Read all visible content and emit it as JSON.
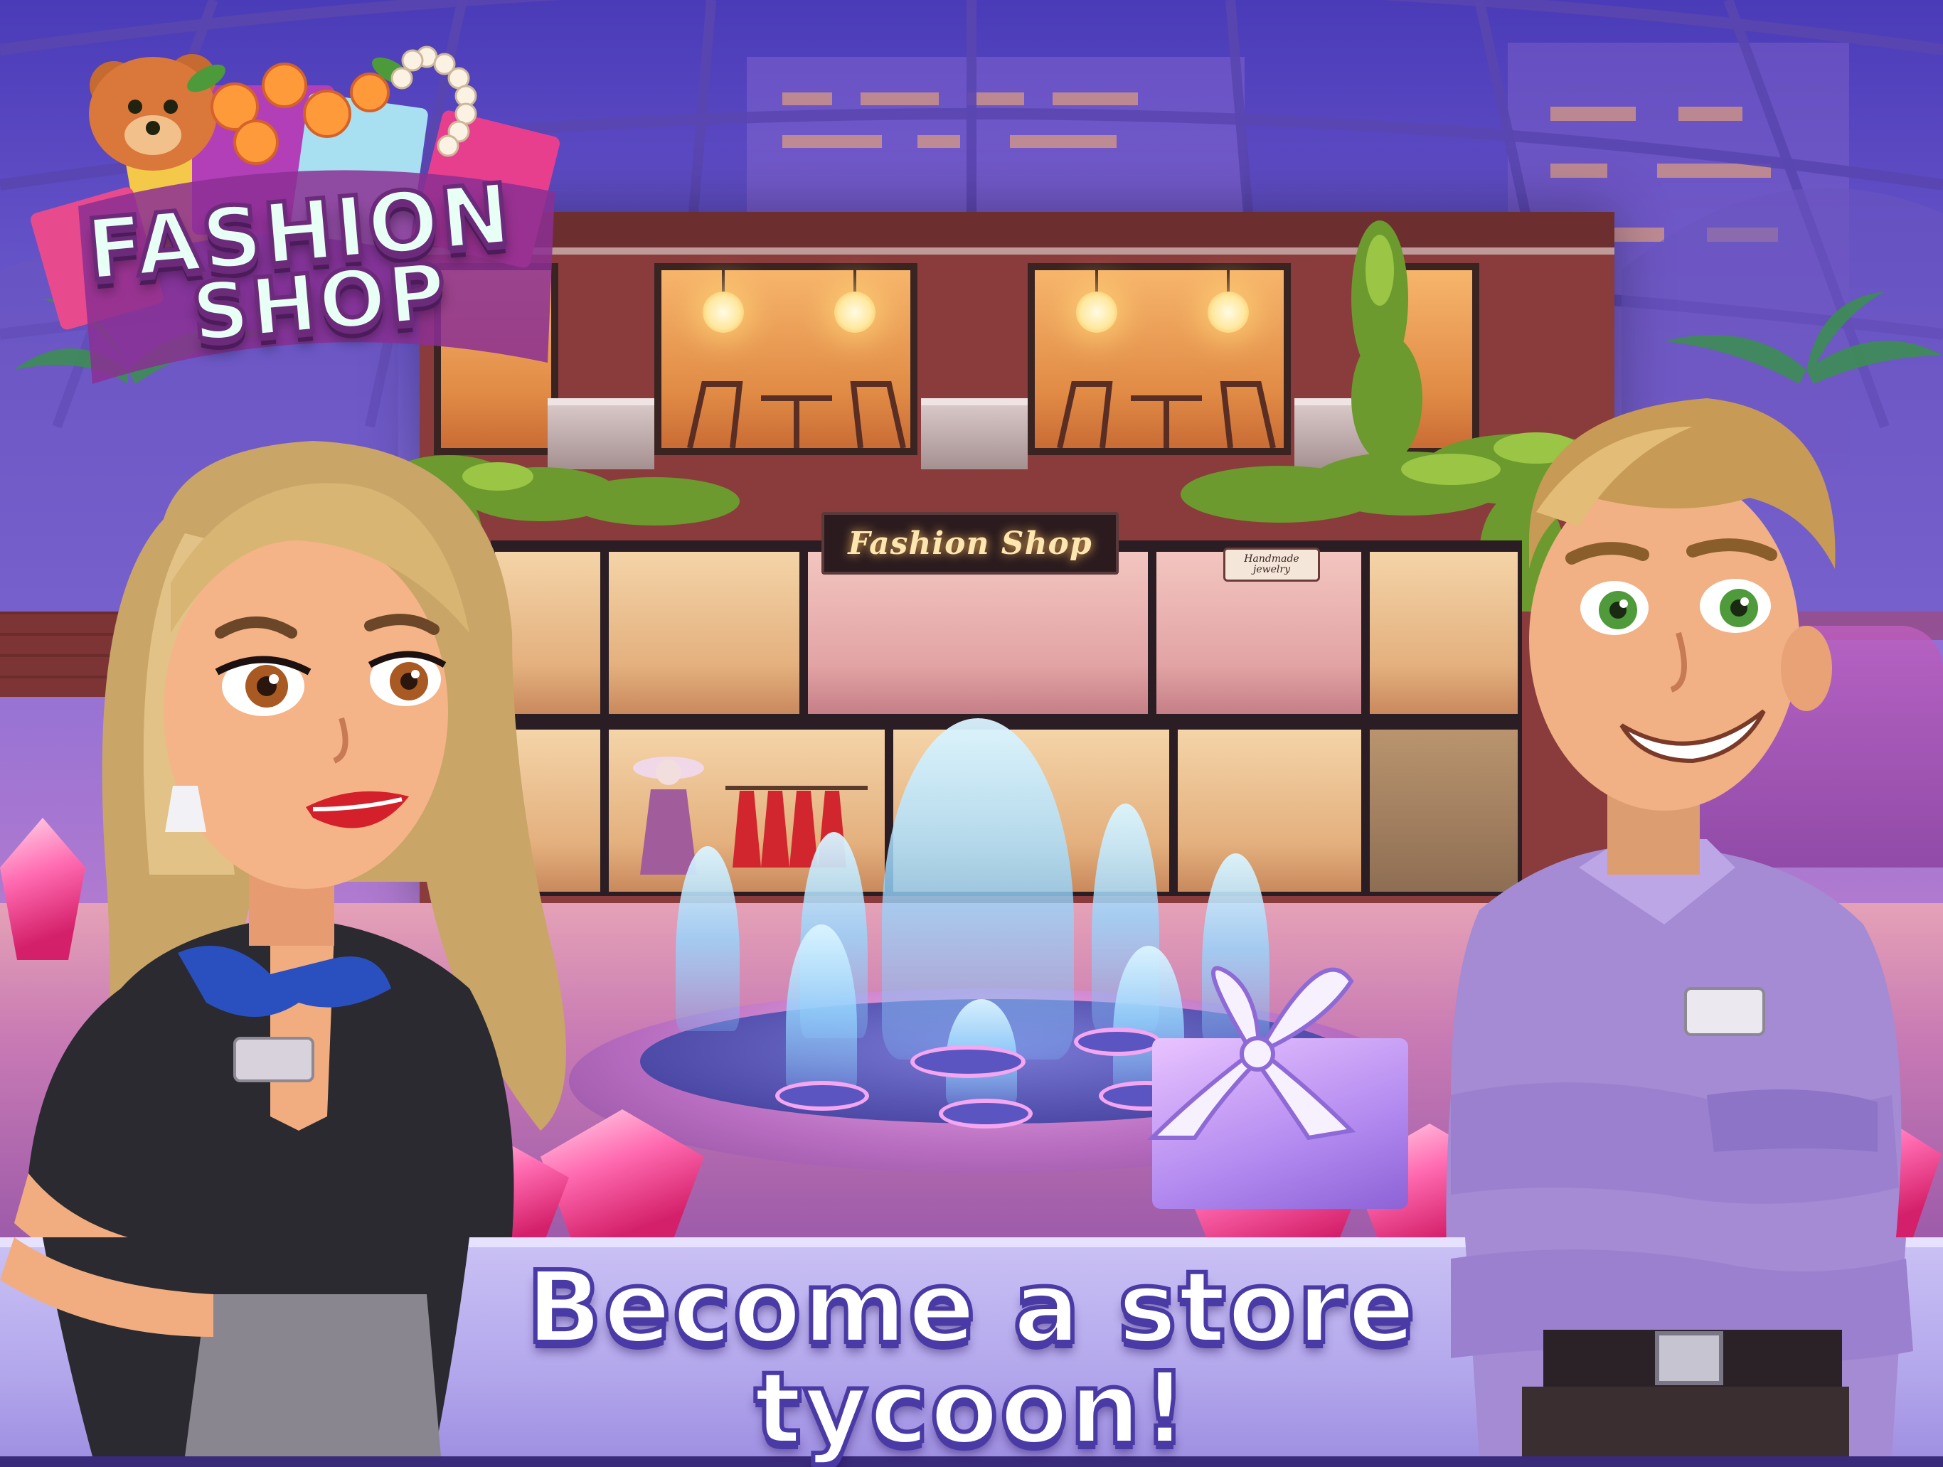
{
  "game": {
    "logo": {
      "line1": "FASHION",
      "line2": "SHOP"
    },
    "shop_sign": "Fashion Shop",
    "store_sign": "Handmade jewelry",
    "tagline": {
      "line1": "Become a store",
      "line2": "tycoon!"
    }
  },
  "colors": {
    "sky": "#5b4bc7",
    "brick": "#8a3c3c",
    "banner": "#b3a7ec",
    "text_stroke": "#4a3aa6",
    "gem": "#ff6ab0",
    "fountain_water": "#9fd8ff"
  },
  "icons": [
    "teddy-bear-icon",
    "rose-bouquet-icon",
    "pearl-necklace-icon",
    "shopping-bag-icon",
    "gift-box-icon",
    "gem-icon"
  ]
}
